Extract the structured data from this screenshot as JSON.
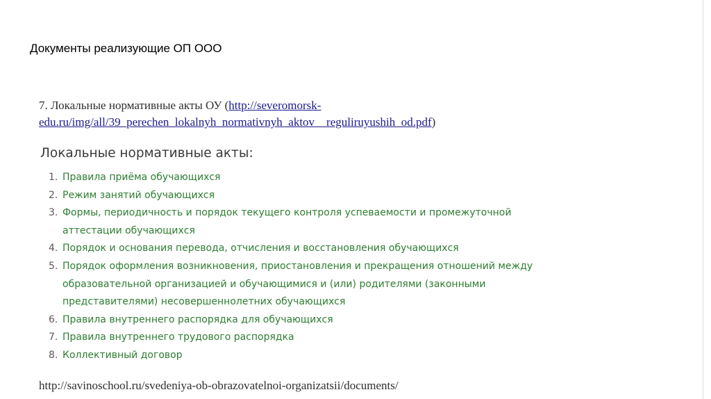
{
  "slide": {
    "title": "Документы реализующие ОП ООО"
  },
  "intro": {
    "prefix": "7. Локальные нормативные акты ОУ (",
    "link_line1": "http://severomorsk-",
    "link_line2": "edu.ru/img/all/39_perechen_lokalnyh_normativnyh_aktov__reguliruyushih_od.pdf",
    "suffix": ")"
  },
  "acts": {
    "heading": "Локальные нормативные акты:",
    "items": [
      {
        "num": "1.",
        "text": "Правила приёма обучающихся"
      },
      {
        "num": "2.",
        "text": "Режим занятий обучающихся"
      },
      {
        "num": "3.",
        "text": "Формы, периодичность и порядок текущего контроля успеваемости и промежуточной аттестации обучающихся"
      },
      {
        "num": "4.",
        "text": "Порядок и основания перевода, отчисления и восстановления обучающихся"
      },
      {
        "num": "5.",
        "text": "Порядок оформления возникновения, приостановления и прекращения отношений между образовательной организацией и обучающимися и (или) родителями (законными представителями) несовершеннолетних обучающихся"
      },
      {
        "num": "6.",
        "text": "Правила внутреннего распорядка для обучающихся"
      },
      {
        "num": "7.",
        "text": "Правила внутреннего трудового распорядка"
      },
      {
        "num": "8.",
        "text": "Коллективный договор"
      }
    ]
  },
  "footer": {
    "url": "http://savinoschool.ru/svedeniya-ob-obrazovatelnoi-organizatsii/documents/"
  }
}
